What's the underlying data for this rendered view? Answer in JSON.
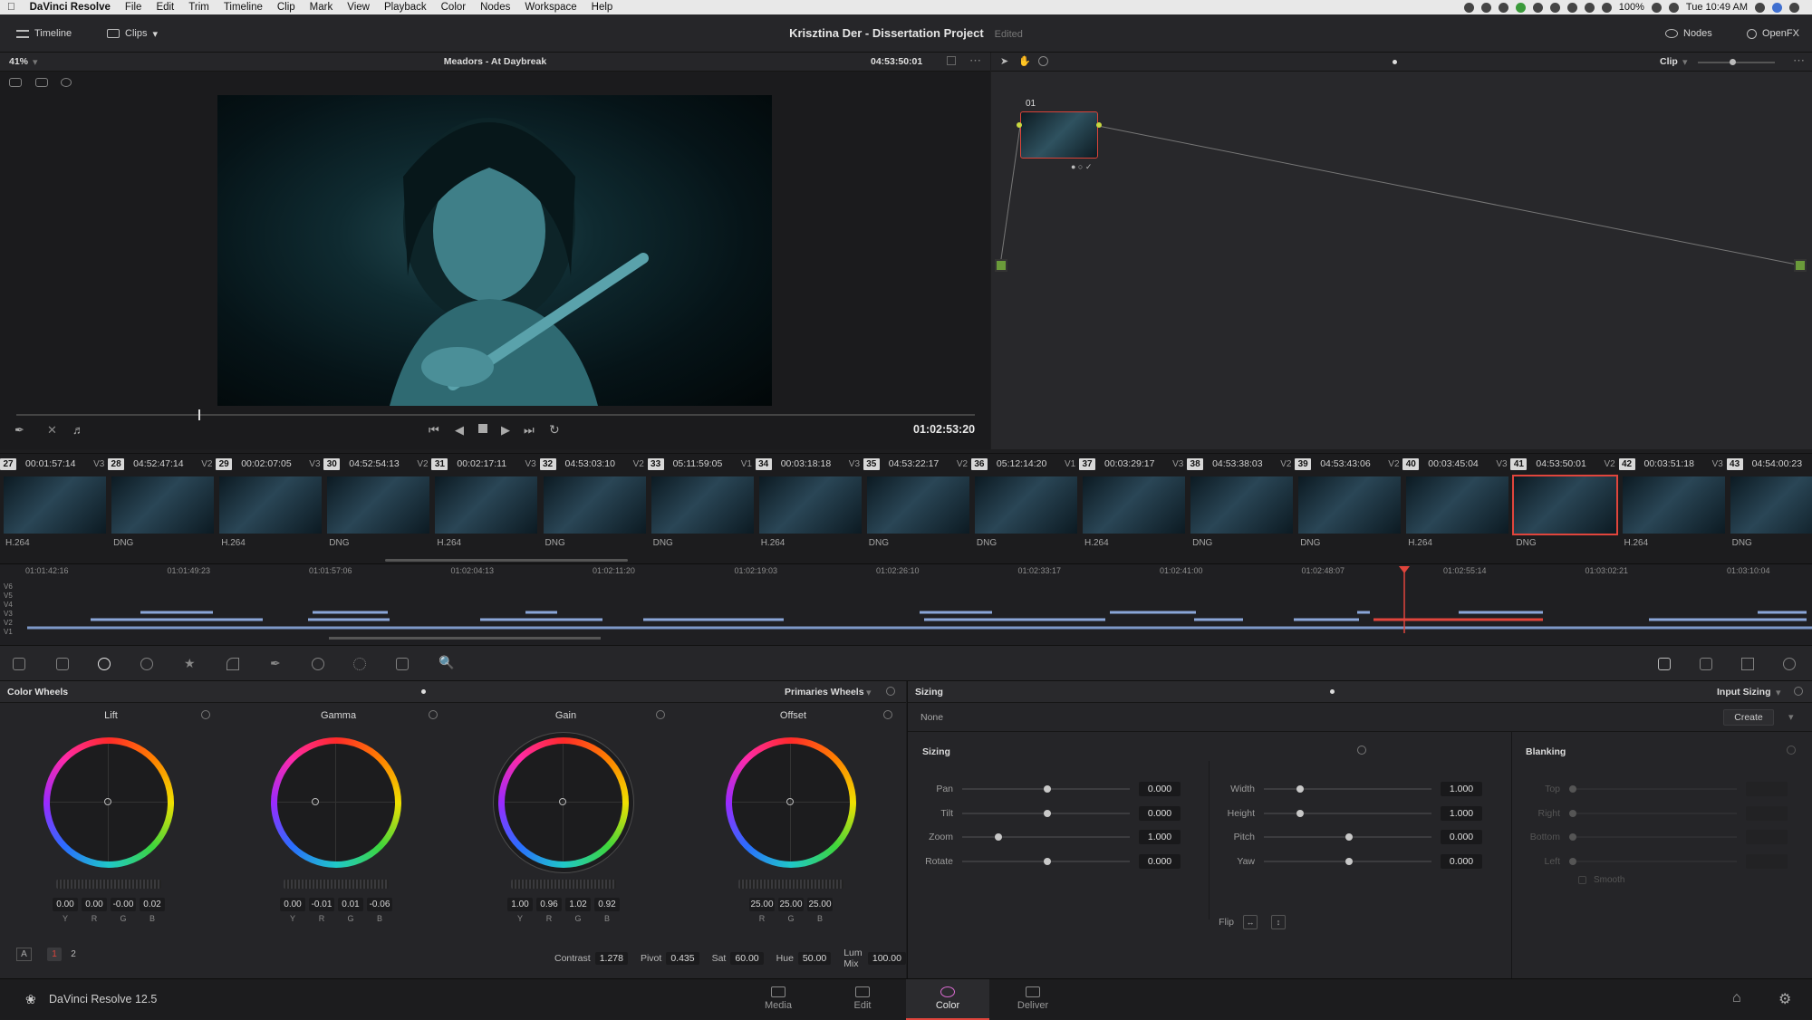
{
  "menubar": {
    "app_name": "DaVinci Resolve",
    "items": [
      "File",
      "Edit",
      "Trim",
      "Timeline",
      "Clip",
      "Mark",
      "View",
      "Playback",
      "Color",
      "Nodes",
      "Workspace",
      "Help"
    ],
    "battery": "100%",
    "clock": "Tue 10:49 AM"
  },
  "header": {
    "timeline_label": "Timeline",
    "clips_label": "Clips",
    "project_title": "Krisztina Der - Dissertation Project",
    "edited_label": "Edited",
    "nodes_label": "Nodes",
    "openfx_label": "OpenFX"
  },
  "viewer": {
    "zoom": "41%",
    "clip_name": "Meadors - At Daybreak",
    "timecode": "04:53:50:01",
    "playhead_timecode": "01:02:53:20",
    "progress": 0.19
  },
  "node_editor": {
    "mode_label": "Clip",
    "node_label": "01"
  },
  "clips": [
    {
      "num": "27",
      "tc": "00:01:57:14",
      "track": "V3",
      "codec": "H.264"
    },
    {
      "num": "28",
      "tc": "04:52:47:14",
      "track": "V2",
      "codec": "DNG"
    },
    {
      "num": "29",
      "tc": "00:02:07:05",
      "track": "V3",
      "codec": "H.264"
    },
    {
      "num": "30",
      "tc": "04:52:54:13",
      "track": "V2",
      "codec": "DNG"
    },
    {
      "num": "31",
      "tc": "00:02:17:11",
      "track": "V3",
      "codec": "H.264"
    },
    {
      "num": "32",
      "tc": "04:53:03:10",
      "track": "V2",
      "codec": "DNG"
    },
    {
      "num": "33",
      "tc": "05:11:59:05",
      "track": "V1",
      "codec": "DNG"
    },
    {
      "num": "34",
      "tc": "00:03:18:18",
      "track": "V3",
      "codec": "H.264"
    },
    {
      "num": "35",
      "tc": "04:53:22:17",
      "track": "V2",
      "codec": "DNG"
    },
    {
      "num": "36",
      "tc": "05:12:14:20",
      "track": "V1",
      "codec": "DNG"
    },
    {
      "num": "37",
      "tc": "00:03:29:17",
      "track": "V3",
      "codec": "H.264"
    },
    {
      "num": "38",
      "tc": "04:53:38:03",
      "track": "V2",
      "codec": "DNG"
    },
    {
      "num": "39",
      "tc": "04:53:43:06",
      "track": "V2",
      "codec": "DNG"
    },
    {
      "num": "40",
      "tc": "00:03:45:04",
      "track": "V3",
      "codec": "H.264"
    },
    {
      "num": "41",
      "tc": "04:53:50:01",
      "track": "V2",
      "codec": "DNG",
      "selected": true
    },
    {
      "num": "42",
      "tc": "00:03:51:18",
      "track": "V3",
      "codec": "H.264"
    },
    {
      "num": "43",
      "tc": "04:54:00:23",
      "track": "",
      "codec": "DNG"
    }
  ],
  "mini_timeline": {
    "ruler": [
      "01:01:42:16",
      "01:01:49:23",
      "01:01:57:06",
      "01:02:04:13",
      "01:02:11:20",
      "01:02:19:03",
      "01:02:26:10",
      "01:02:33:17",
      "01:02:41:00",
      "01:02:48:07",
      "01:02:55:14",
      "01:03:02:21",
      "01:03:10:04"
    ],
    "tracks": [
      "V6",
      "V5",
      "V4",
      "V3",
      "V2",
      "V1"
    ]
  },
  "color_wheels": {
    "title": "Color Wheels",
    "mode": "Primaries Wheels",
    "wheels": [
      {
        "name": "Lift",
        "values": [
          "0.00",
          "0.00",
          "-0.00",
          "0.02"
        ],
        "labels": [
          "Y",
          "R",
          "G",
          "B"
        ]
      },
      {
        "name": "Gamma",
        "values": [
          "0.00",
          "-0.01",
          "0.01",
          "-0.06"
        ],
        "labels": [
          "Y",
          "R",
          "G",
          "B"
        ]
      },
      {
        "name": "Gain",
        "values": [
          "1.00",
          "0.96",
          "1.02",
          "0.92"
        ],
        "labels": [
          "Y",
          "R",
          "G",
          "B"
        ]
      },
      {
        "name": "Offset",
        "values": [
          "25.00",
          "25.00",
          "25.00"
        ],
        "labels": [
          "R",
          "G",
          "B"
        ]
      }
    ],
    "footer": {
      "a_label": "A",
      "page1": "1",
      "page2": "2",
      "contrast_label": "Contrast",
      "contrast": "1.278",
      "pivot_label": "Pivot",
      "pivot": "0.435",
      "sat_label": "Sat",
      "sat": "60.00",
      "hue_label": "Hue",
      "hue": "50.00",
      "lummix_label": "Lum Mix",
      "lummix": "100.00"
    }
  },
  "sizing": {
    "title": "Sizing",
    "mode": "Input Sizing",
    "preset": "None",
    "create_label": "Create",
    "section": "Sizing",
    "blanking": "Blanking",
    "left_rows": [
      {
        "label": "Pan",
        "value": "0.000",
        "pos": 0.5
      },
      {
        "label": "Tilt",
        "value": "0.000",
        "pos": 0.5
      },
      {
        "label": "Zoom",
        "value": "1.000",
        "pos": 0.2
      },
      {
        "label": "Rotate",
        "value": "0.000",
        "pos": 0.5
      }
    ],
    "right_rows": [
      {
        "label": "Width",
        "value": "1.000",
        "pos": 0.2
      },
      {
        "label": "Height",
        "value": "1.000",
        "pos": 0.2
      },
      {
        "label": "Pitch",
        "value": "0.000",
        "pos": 0.5
      },
      {
        "label": "Yaw",
        "value": "0.000",
        "pos": 0.5
      }
    ],
    "flip_label": "Flip",
    "blank_rows": [
      "Top",
      "Right",
      "Bottom",
      "Left"
    ],
    "smooth_label": "Smooth"
  },
  "bottom": {
    "product": "DaVinci Resolve 12.5",
    "tabs": [
      "Media",
      "Edit",
      "Color",
      "Deliver"
    ],
    "active_tab": "Color"
  }
}
